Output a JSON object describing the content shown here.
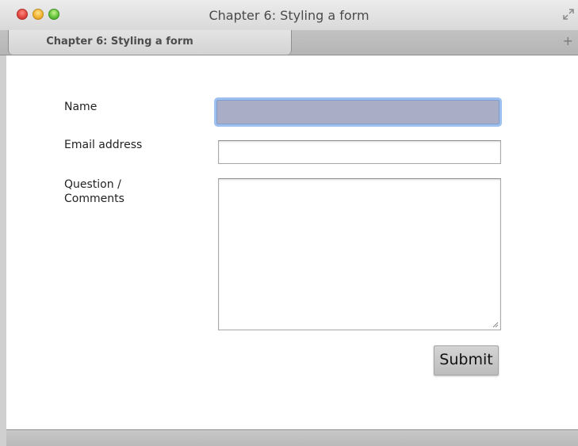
{
  "window": {
    "title": "Chapter 6: Styling a form",
    "controls": [
      "close",
      "minimize",
      "zoom"
    ],
    "fullscreen_icon": "fullscreen-arrows-icon"
  },
  "tabs": [
    {
      "label": "Chapter 6: Styling a form",
      "active": true
    }
  ],
  "new_tab_symbol": "+",
  "form": {
    "name_label": "Name",
    "name_value": "",
    "email_label": "Email address",
    "email_value": "",
    "question_label": "Question / Comments",
    "question_value": "",
    "submit_label": "Submit"
  },
  "colors": {
    "focused_input_bg": "#a9aec6",
    "focus_ring": "#9ec1ef"
  }
}
